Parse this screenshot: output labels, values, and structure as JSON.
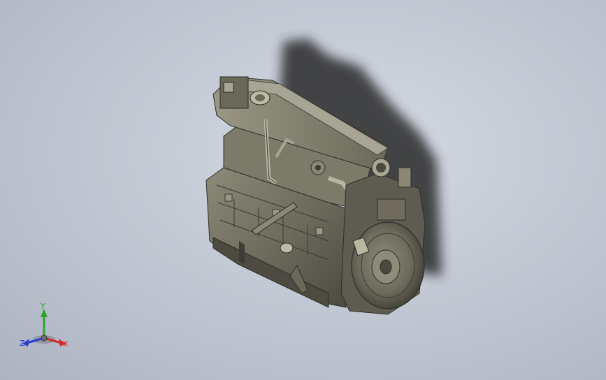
{
  "viewport": {
    "background_color": "#c3c9d4",
    "model": {
      "body_color": "#6f6c5e",
      "highlight_color": "#a8a594",
      "shadow_color": "#2c2c2c"
    }
  },
  "triad": {
    "x_label": "X",
    "y_label": "Y",
    "z_label": "Z",
    "x_color": "#d02a2a",
    "y_color": "#2ea52e",
    "z_color": "#2a3fd0"
  }
}
